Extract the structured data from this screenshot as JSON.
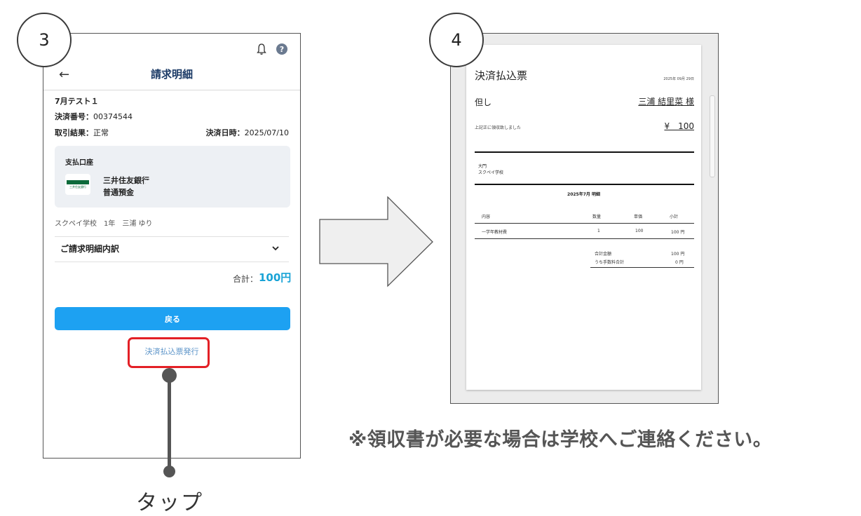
{
  "steps": {
    "left": "3",
    "right": "4"
  },
  "phone": {
    "title": "請求明細",
    "back_arrow": "←",
    "help_icon": "?",
    "bill_name": "7月テスト１",
    "payment_number_label": "決済番号：",
    "payment_number": "00374544",
    "result_label": "取引結果：",
    "result_value": "正常",
    "date_label": "決済日時：",
    "date_value": "2025/07/10",
    "account_section_label": "支払口座",
    "bank_logo_text": "三井住友銀行",
    "bank_name": "三井住友銀行",
    "account_type": "普通預金",
    "student_info": "スクペイ学校　1年　三浦 ゆり",
    "breakdown_label": "ご請求明細内訳",
    "total_label": "合計：",
    "total_value": "100円",
    "back_button": "戻る",
    "issue_link": "決済払込票発行"
  },
  "tap_label": "タップ",
  "receipt": {
    "title": "決済払込票",
    "date": "2025年 09月 29日",
    "tadashi": "但し",
    "recipient": "三浦 結里菜 様",
    "received_text": "上記正に領収致しました",
    "amount": "¥　100",
    "issuer_line1": "大門",
    "issuer_line2": "スクペイ学校",
    "detail_title": "2025年7月 明細",
    "table": {
      "headers": [
        "内容",
        "数量",
        "単価",
        "小計"
      ],
      "rows": [
        [
          "一学年教材費",
          "1",
          "100",
          "100 円"
        ]
      ]
    },
    "summary": [
      {
        "label": "合計金額",
        "value": "100 円"
      },
      {
        "label": "うち手数料合計",
        "value": "0 円"
      }
    ]
  },
  "note": "※領収書が必要な場合は学校へご連絡ください。",
  "colors": {
    "primary_button": "#1da1f2",
    "total_accent": "#19a3d6",
    "highlight": "#e32026",
    "title_navy": "#1b3a66"
  }
}
